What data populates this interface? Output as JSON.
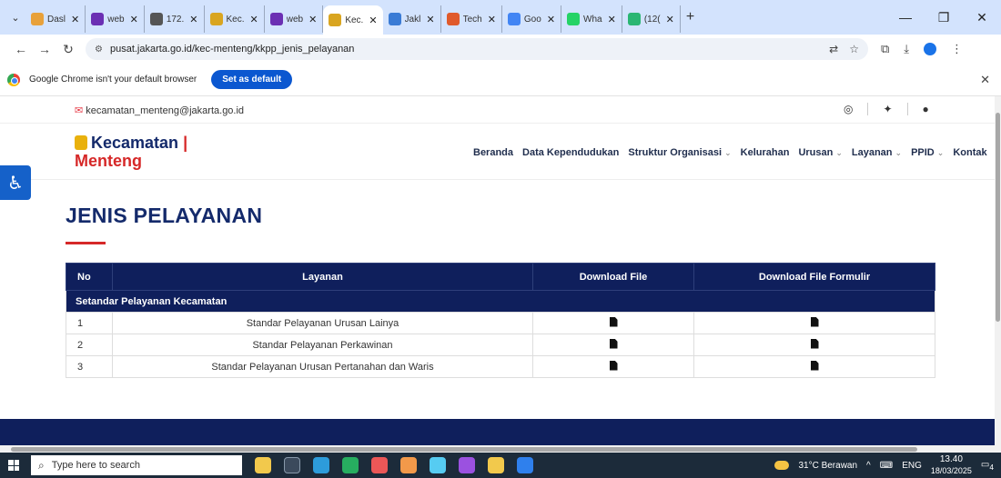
{
  "browser": {
    "tabs": [
      {
        "title": "Dasl",
        "color": "#e8a13a",
        "active": false
      },
      {
        "title": "web",
        "color": "#6b2fb3",
        "active": false
      },
      {
        "title": "172.",
        "color": "#555555",
        "active": false
      },
      {
        "title": "Kec.",
        "color": "#d9a520",
        "active": false
      },
      {
        "title": "web",
        "color": "#6b2fb3",
        "active": false
      },
      {
        "title": "Kec.",
        "color": "#d9a520",
        "active": true
      },
      {
        "title": "Jakl",
        "color": "#3a7bd5",
        "active": false
      },
      {
        "title": "Tech",
        "color": "#e05a2b",
        "active": false
      },
      {
        "title": "Goo",
        "color": "#4285f4",
        "active": false
      },
      {
        "title": "Wha",
        "color": "#25d366",
        "active": false
      },
      {
        "title": "(12(",
        "color": "#2bb673",
        "active": false
      }
    ],
    "url": "pusat.jakarta.go.id/kec-menteng/kkpp_jenis_pelayanan",
    "infobar_text": "Google Chrome isn't your default browser",
    "set_default_label": "Set as default"
  },
  "site": {
    "email": "kecamatan_menteng@jakarta.go.id",
    "logo_line1": "Kecamatan",
    "logo_bar": "|",
    "logo_line2": "Menteng",
    "menu": [
      {
        "label": "Beranda",
        "dropdown": false
      },
      {
        "label": "Data Kependudukan",
        "dropdown": false
      },
      {
        "label": "Struktur Organisasi",
        "dropdown": true
      },
      {
        "label": "Kelurahan",
        "dropdown": false
      },
      {
        "label": "Urusan",
        "dropdown": true
      },
      {
        "label": "Layanan",
        "dropdown": true
      },
      {
        "label": "PPID",
        "dropdown": true
      },
      {
        "label": "Kontak",
        "dropdown": false
      }
    ],
    "page_title": "JENIS PELAYANAN",
    "table": {
      "headers": [
        "No",
        "Layanan",
        "Download File",
        "Download File Formulir"
      ],
      "section": "Setandar Pelayanan Kecamatan",
      "rows": [
        {
          "no": "1",
          "layanan": "Standar Pelayanan Urusan Lainya"
        },
        {
          "no": "2",
          "layanan": "Standar Pelayanan Perkawinan"
        },
        {
          "no": "3",
          "layanan": "Standar Pelayanan Urusan Pertanahan dan Waris"
        }
      ]
    }
  },
  "taskbar": {
    "search_placeholder": "Type here to search",
    "weather": "31°C Berawan",
    "lang": "ENG",
    "time": "13.40",
    "date": "18/03/2025",
    "notif_count": "4"
  }
}
